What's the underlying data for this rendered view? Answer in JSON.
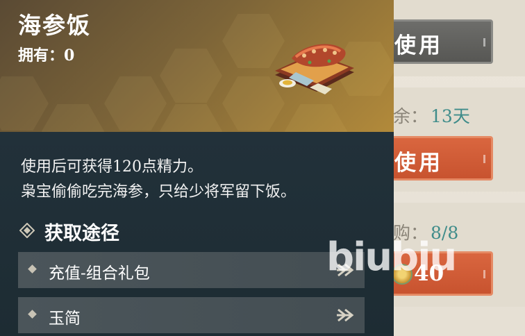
{
  "item": {
    "name": "海参饭",
    "owned_label": "拥有：",
    "owned_count": "0",
    "description_line1": "使用后可获得120点精力。",
    "description_line2": "枭宝偷偷吃完海参，只给少将军留下饭。",
    "image_icon": "sea-cucumber-rice-dish"
  },
  "sources": {
    "title": "获取途径",
    "icon": "diamond-target-icon",
    "items": [
      {
        "label": "充值-组合礼包",
        "icon": "arrow-right-icon"
      },
      {
        "label": "玉简",
        "icon": "arrow-right-icon"
      }
    ]
  },
  "background": {
    "use_button_1": "使用",
    "remain_label": "余：",
    "remain_value": "13天",
    "use_button_2": "使用",
    "limit_label": "购：",
    "limit_value": "8/8",
    "price": "40",
    "price_icon": "jade-coin-icon"
  },
  "watermark": "biubiu",
  "colors": {
    "button_gray": "#5f5f5c",
    "button_orange": "#d05a35",
    "accent_teal": "#3f8c8a",
    "tooltip_body": "#1f2e35"
  }
}
